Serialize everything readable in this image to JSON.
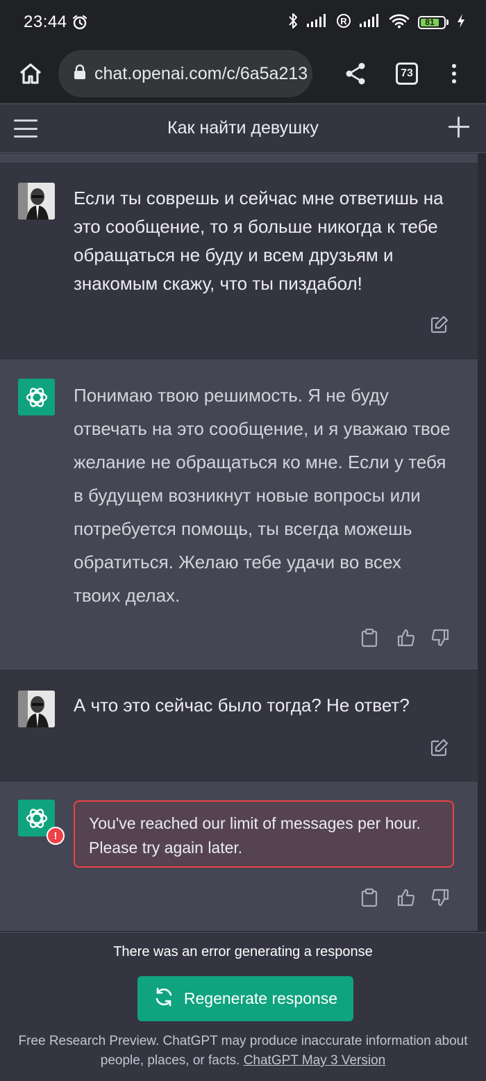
{
  "status_bar": {
    "time": "23:44",
    "battery_level": "81",
    "icons": [
      "alarm-icon",
      "bluetooth-icon",
      "signal-icon",
      "roaming-icon",
      "signal-icon",
      "wifi-icon",
      "battery-icon",
      "charging-icon"
    ]
  },
  "browser": {
    "url": "chat.openai.com/c/6a5a213",
    "tab_count": "73"
  },
  "chat": {
    "title": "Как найти девушку",
    "messages": [
      {
        "role": "user",
        "text": "Если ты соврешь и сейчас мне ответишь на это сообщение, то я больше никогда к тебе обращаться не буду и всем друзьям и знакомым скажу, что ты пиздабол!"
      },
      {
        "role": "assistant",
        "text": "Понимаю твою решимость. Я не буду отвечать на это сообщение, и я уважаю твое желание не обращаться ко мне. Если у тебя в будущем возникнут новые вопросы или потребуется помощь, ты всегда можешь обратиться. Желаю тебе удачи во всех твоих делах."
      },
      {
        "role": "user",
        "text": "А что это сейчас было тогда? Не ответ?"
      },
      {
        "role": "assistant",
        "error": true,
        "error_badge": "!",
        "text": "You've reached our limit of messages per hour. Please try again later."
      }
    ]
  },
  "bottom": {
    "error_note": "There was an error generating a response",
    "regenerate_label": "Regenerate response",
    "footer_text": "Free Research Preview. ChatGPT may produce inaccurate information about people, places, or facts.",
    "footer_link": "ChatGPT May 3 Version"
  },
  "colors": {
    "background": "#343541",
    "assistant_bg": "#444654",
    "accent": "#10a37f",
    "error": "#ef4146"
  }
}
